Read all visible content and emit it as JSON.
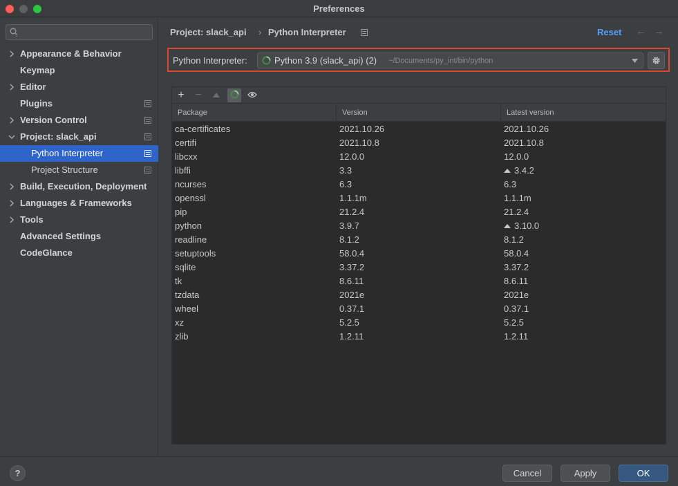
{
  "window": {
    "title": "Preferences"
  },
  "search": {
    "placeholder": ""
  },
  "sidebar": {
    "items": [
      {
        "label": "Appearance & Behavior",
        "expandable": true,
        "expanded": false,
        "settings_icon": false
      },
      {
        "label": "Keymap",
        "expandable": false,
        "settings_icon": false
      },
      {
        "label": "Editor",
        "expandable": true,
        "expanded": false,
        "settings_icon": false
      },
      {
        "label": "Plugins",
        "expandable": false,
        "settings_icon": true
      },
      {
        "label": "Version Control",
        "expandable": true,
        "expanded": false,
        "settings_icon": true
      },
      {
        "label": "Project: slack_api",
        "expandable": true,
        "expanded": true,
        "settings_icon": true
      },
      {
        "label": "Python Interpreter",
        "child": true,
        "selected": true,
        "settings_icon": true
      },
      {
        "label": "Project Structure",
        "child": true,
        "settings_icon": true
      },
      {
        "label": "Build, Execution, Deployment",
        "expandable": true,
        "expanded": false,
        "settings_icon": false
      },
      {
        "label": "Languages & Frameworks",
        "expandable": true,
        "expanded": false,
        "settings_icon": false
      },
      {
        "label": "Tools",
        "expandable": true,
        "expanded": false,
        "settings_icon": false
      },
      {
        "label": "Advanced Settings",
        "expandable": false,
        "settings_icon": false
      },
      {
        "label": "CodeGlance",
        "expandable": false,
        "settings_icon": false
      }
    ]
  },
  "breadcrumb": {
    "parent": "Project: slack_api",
    "separator": "›",
    "current": "Python Interpreter"
  },
  "header": {
    "reset_label": "Reset",
    "back_glyph": "←",
    "forward_glyph": "→"
  },
  "interpreter": {
    "label": "Python Interpreter:",
    "name": "Python 3.9 (slack_api) (2)",
    "path": "~/Documents/py_int/bin/python",
    "highlight_color": "#e0462c"
  },
  "toolbar": {
    "add_glyph": "+",
    "remove_glyph": "−"
  },
  "packages": {
    "columns": [
      "Package",
      "Version",
      "Latest version"
    ],
    "rows": [
      {
        "name": "ca-certificates",
        "version": "2021.10.26",
        "latest": "2021.10.26",
        "upgrade": false
      },
      {
        "name": "certifi",
        "version": "2021.10.8",
        "latest": "2021.10.8",
        "upgrade": false
      },
      {
        "name": "libcxx",
        "version": "12.0.0",
        "latest": "12.0.0",
        "upgrade": false
      },
      {
        "name": "libffi",
        "version": "3.3",
        "latest": "3.4.2",
        "upgrade": true
      },
      {
        "name": "ncurses",
        "version": "6.3",
        "latest": "6.3",
        "upgrade": false
      },
      {
        "name": "openssl",
        "version": "1.1.1m",
        "latest": "1.1.1m",
        "upgrade": false
      },
      {
        "name": "pip",
        "version": "21.2.4",
        "latest": "21.2.4",
        "upgrade": false
      },
      {
        "name": "python",
        "version": "3.9.7",
        "latest": "3.10.0",
        "upgrade": true
      },
      {
        "name": "readline",
        "version": "8.1.2",
        "latest": "8.1.2",
        "upgrade": false
      },
      {
        "name": "setuptools",
        "version": "58.0.4",
        "latest": "58.0.4",
        "upgrade": false
      },
      {
        "name": "sqlite",
        "version": "3.37.2",
        "latest": "3.37.2",
        "upgrade": false
      },
      {
        "name": "tk",
        "version": "8.6.11",
        "latest": "8.6.11",
        "upgrade": false
      },
      {
        "name": "tzdata",
        "version": "2021e",
        "latest": "2021e",
        "upgrade": false
      },
      {
        "name": "wheel",
        "version": "0.37.1",
        "latest": "0.37.1",
        "upgrade": false
      },
      {
        "name": "xz",
        "version": "5.2.5",
        "latest": "5.2.5",
        "upgrade": false
      },
      {
        "name": "zlib",
        "version": "1.2.11",
        "latest": "1.2.11",
        "upgrade": false
      }
    ]
  },
  "footer": {
    "help_label": "?",
    "cancel_label": "Cancel",
    "apply_label": "Apply",
    "ok_label": "OK"
  },
  "colors": {
    "accent": "#2f65ca",
    "link": "#589df6",
    "ok_button": "#365880"
  },
  "icons": {
    "search": "search-icon",
    "settings": "settings-page-icon",
    "gear": "gear-icon",
    "spinner": "loading-spinner-icon",
    "eye": "eye-icon",
    "upgrade": "upgrade-arrow-icon"
  }
}
